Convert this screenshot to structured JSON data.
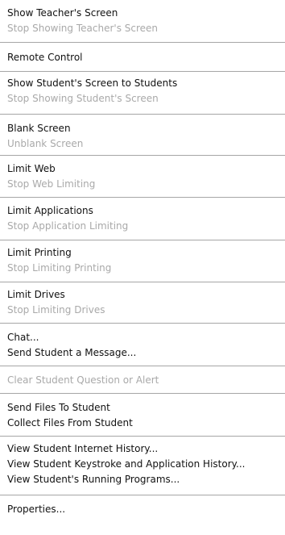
{
  "menu": {
    "groups": [
      {
        "items": [
          {
            "label": "Show Teacher's Screen",
            "enabled": true
          },
          {
            "label": "Stop Showing Teacher's Screen",
            "enabled": false
          }
        ]
      },
      {
        "items": [
          {
            "label": "Remote Control",
            "enabled": true
          }
        ]
      },
      {
        "items": [
          {
            "label": "Show Student's Screen to Students",
            "enabled": true
          },
          {
            "label": "Stop Showing Student's Screen",
            "enabled": false
          }
        ]
      },
      {
        "items": [
          {
            "label": "Blank Screen",
            "enabled": true
          },
          {
            "label": "Unblank Screen",
            "enabled": false
          }
        ]
      },
      {
        "items": [
          {
            "label": "Limit Web",
            "enabled": true
          },
          {
            "label": "Stop Web Limiting",
            "enabled": false
          }
        ]
      },
      {
        "items": [
          {
            "label": "Limit Applications",
            "enabled": true
          },
          {
            "label": "Stop Application Limiting",
            "enabled": false
          }
        ]
      },
      {
        "items": [
          {
            "label": "Limit Printing",
            "enabled": true
          },
          {
            "label": "Stop Limiting Printing",
            "enabled": false
          }
        ]
      },
      {
        "items": [
          {
            "label": "Limit Drives",
            "enabled": true
          },
          {
            "label": "Stop Limiting Drives",
            "enabled": false
          }
        ]
      },
      {
        "items": [
          {
            "label": "Chat...",
            "enabled": true
          },
          {
            "label": "Send Student a Message...",
            "enabled": true
          }
        ]
      },
      {
        "items": [
          {
            "label": "Clear Student Question or Alert",
            "enabled": false
          }
        ]
      },
      {
        "items": [
          {
            "label": "Send Files To Student",
            "enabled": true
          },
          {
            "label": "Collect Files From Student",
            "enabled": true
          }
        ]
      },
      {
        "items": [
          {
            "label": "View Student Internet History...",
            "enabled": true
          },
          {
            "label": "View Student Keystroke and Application History...",
            "enabled": true
          },
          {
            "label": "View Student's Running Programs...",
            "enabled": true
          }
        ]
      },
      {
        "items": [
          {
            "label": "Properties...",
            "enabled": true
          }
        ]
      }
    ]
  }
}
